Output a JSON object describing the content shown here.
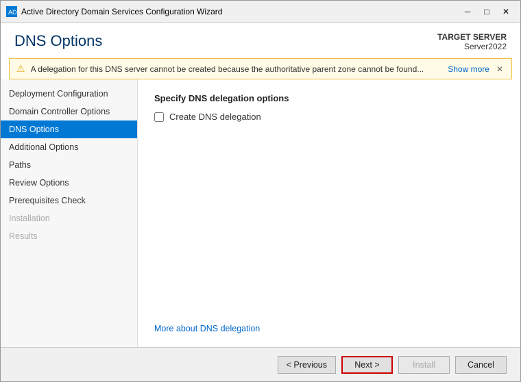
{
  "window": {
    "title": "Active Directory Domain Services Configuration Wizard",
    "icon": "AD"
  },
  "titlebar": {
    "minimize": "─",
    "maximize": "□",
    "close": "✕"
  },
  "header": {
    "title": "DNS Options",
    "server_label": "TARGET SERVER",
    "server_name": "Server2022"
  },
  "warning": {
    "icon": "⚠",
    "text": "A delegation for this DNS server cannot be created because the authoritative parent zone cannot be found...",
    "show_more": "Show more",
    "close": "✕"
  },
  "sidebar": {
    "items": [
      {
        "label": "Deployment Configuration",
        "state": "normal"
      },
      {
        "label": "Domain Controller Options",
        "state": "normal"
      },
      {
        "label": "DNS Options",
        "state": "active"
      },
      {
        "label": "Additional Options",
        "state": "normal"
      },
      {
        "label": "Paths",
        "state": "normal"
      },
      {
        "label": "Review Options",
        "state": "normal"
      },
      {
        "label": "Prerequisites Check",
        "state": "normal"
      },
      {
        "label": "Installation",
        "state": "disabled"
      },
      {
        "label": "Results",
        "state": "disabled"
      }
    ]
  },
  "content": {
    "section_title": "Specify DNS delegation options",
    "checkbox_label": "Create DNS delegation",
    "link_text": "More about DNS delegation"
  },
  "footer": {
    "previous": "< Previous",
    "next": "Next >",
    "install": "Install",
    "cancel": "Cancel"
  }
}
